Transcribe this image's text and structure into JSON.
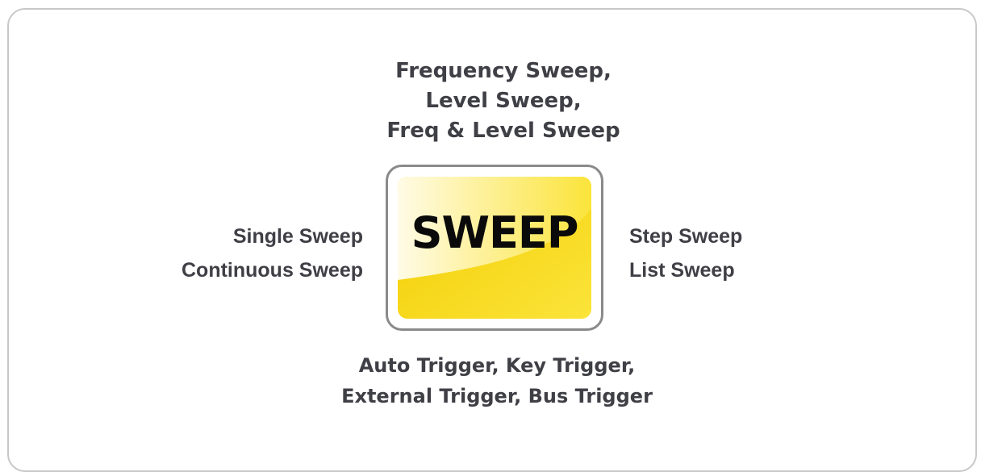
{
  "top_modes": [
    "Frequency Sweep,",
    "Level Sweep,",
    "Freq & Level Sweep"
  ],
  "left_modes": [
    "Single Sweep",
    "Continuous Sweep"
  ],
  "right_modes": [
    "Step Sweep",
    "List Sweep"
  ],
  "bottom_modes": [
    "Auto Trigger, Key Trigger,",
    "External Trigger, Bus Trigger"
  ],
  "center": {
    "label": "SWEEP",
    "colors": {
      "gold": "#f2cc00",
      "yellow": "#fbe43a",
      "light": "#fffbe6",
      "border": "#8a8a8a"
    }
  }
}
